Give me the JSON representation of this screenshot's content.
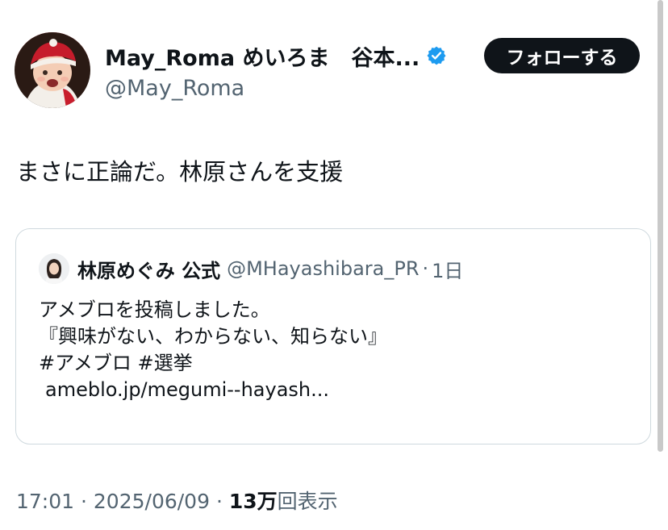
{
  "author": {
    "display_name": "May_Roma めいろま　谷本...",
    "handle": "@May_Roma",
    "verified_color": "#1d9bf0"
  },
  "follow_button": {
    "label": "フォローする"
  },
  "tweet": {
    "text": "まさに正論だ。林原さんを支援"
  },
  "quote": {
    "name": "林原めぐみ 公式",
    "handle": "@MHayashibara_PR",
    "separator": "·",
    "time": "1日",
    "lines": [
      "アメブロを投稿しました。",
      "『興味がない、わからない、知らない』",
      "#アメブロ  #選挙",
      "ameblo.jp/megumi--hayash..."
    ]
  },
  "meta": {
    "time": "17:01",
    "separator": "·",
    "date": "2025/06/09",
    "views_count": "13万",
    "views_label": "回表示"
  }
}
